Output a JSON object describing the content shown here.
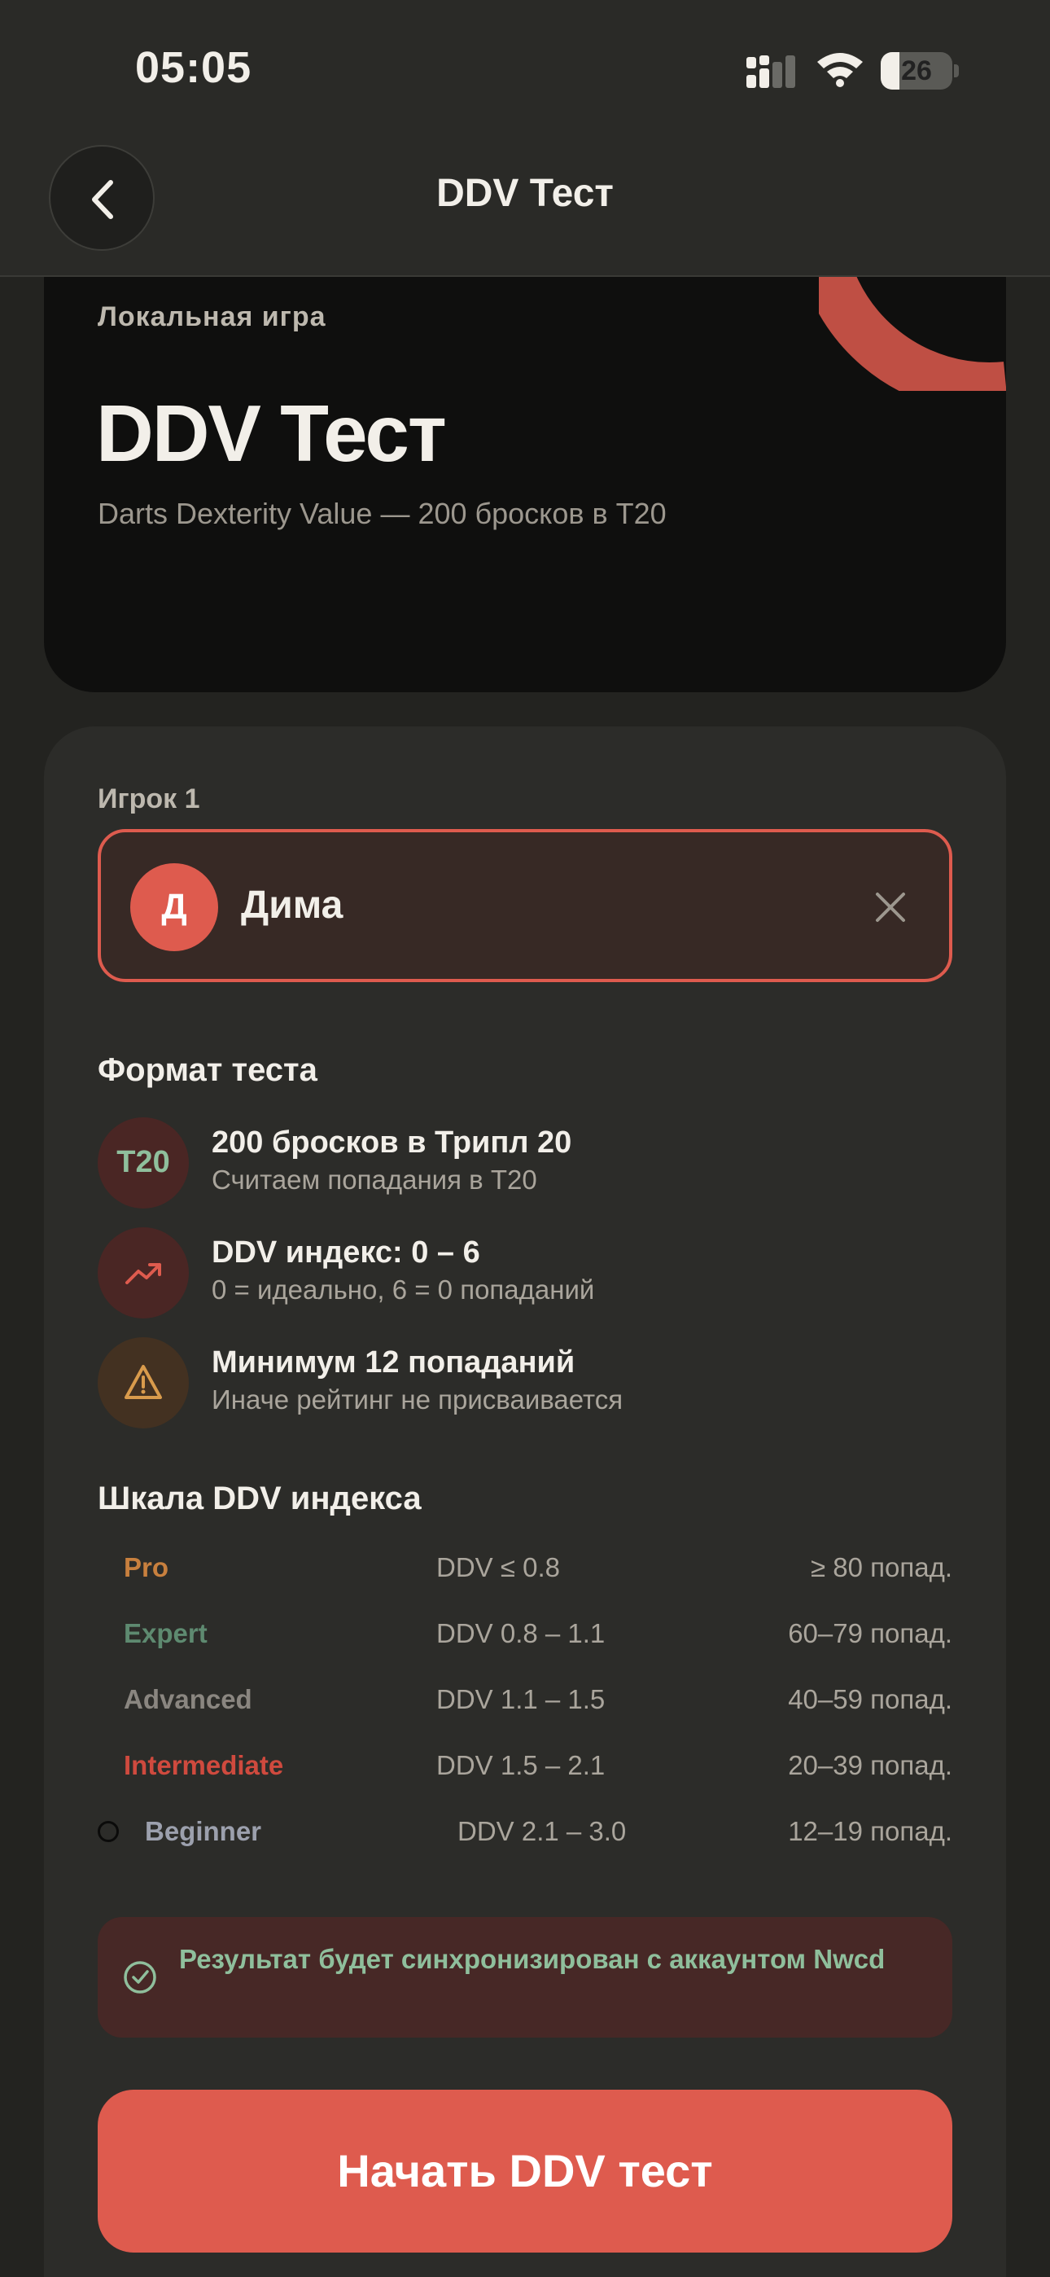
{
  "status": {
    "time": "05:05",
    "battery": "26",
    "battery_level": 0.26
  },
  "nav": {
    "title": "DDV Тест"
  },
  "hero": {
    "label": "Локальная игра",
    "title": "DDV Тест",
    "description": "Darts Dexterity Value — 200 бросков в T20"
  },
  "player": {
    "label": "Игрок 1",
    "initial": "Д",
    "name": "Дима"
  },
  "format": {
    "title": "Формат теста",
    "items": [
      {
        "icon": "T20",
        "title": "200 бросков в Трипл 20",
        "subtitle": "Считаем попадания в T20"
      },
      {
        "icon": "trending-up-icon",
        "title": "DDV индекс: 0 – 6",
        "subtitle": "0 = идеально, 6 = 0 попаданий"
      },
      {
        "icon": "warning-icon",
        "title": "Минимум 12 попаданий",
        "subtitle": "Иначе рейтинг не присваивается"
      }
    ]
  },
  "scale": {
    "title": "Шкала DDV индекса",
    "rows": [
      {
        "name": "Pro",
        "range": "DDV ≤ 0.8",
        "hits": "≥ 80 попад.",
        "color": "#c8803e"
      },
      {
        "name": "Expert",
        "range": "DDV 0.8 – 1.1",
        "hits": "60–79 попад.",
        "color": "#5e8a70"
      },
      {
        "name": "Advanced",
        "range": "DDV 1.1 – 1.5",
        "hits": "40–59 попад.",
        "color": "#8a8680"
      },
      {
        "name": "Intermediate",
        "range": "DDV 1.5 – 2.1",
        "hits": "20–39 попад.",
        "color": "#cf4a3e"
      },
      {
        "name": "Beginner",
        "range": "DDV 2.1 – 3.0",
        "hits": "12–19 попад.",
        "color": "#9ca0ad"
      }
    ]
  },
  "sync": {
    "text": "Результат будет синхронизирован с аккаунтом Nwcd"
  },
  "start_button": {
    "label": "Начать DDV тест"
  },
  "colors": {
    "accent": "#de5b4e",
    "success": "#8fbf9c",
    "background": "#232320"
  }
}
